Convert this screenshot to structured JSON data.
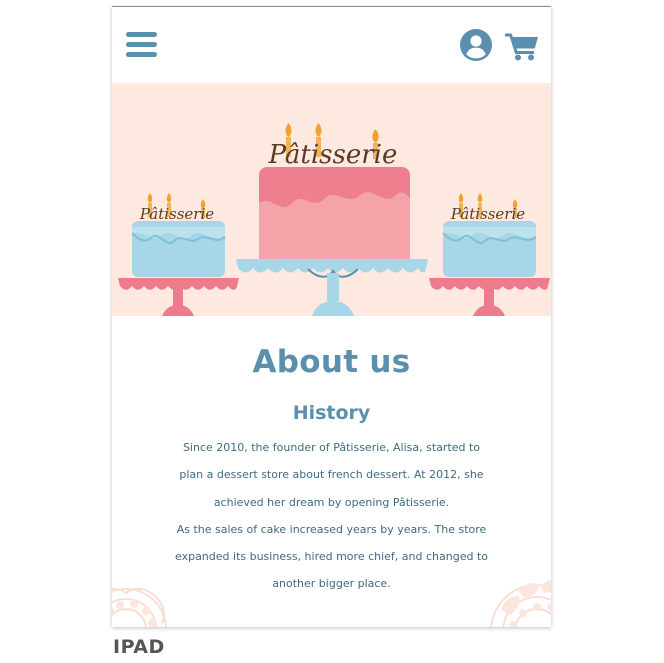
{
  "header": {
    "menu_icon": "hamburger-menu-icon",
    "account_icon": "user-circle-icon",
    "cart_icon": "shopping-cart-icon"
  },
  "hero": {
    "brand_main": "Pâtisserie",
    "brand_left": "Pâtisserie",
    "brand_right": "Pâtisserie"
  },
  "about": {
    "title": "About us",
    "subtitle": "History",
    "lines": [
      "Since 2010, the founder of Pâtisserie, Alisa, started to",
      "plan a dessert store about french dessert. At 2012, she",
      "achieved her dream by opening Pâtisserie.",
      "As the sales of cake increased years by years. The store",
      "expanded its business, hired more chief, and changed to",
      "another bigger place."
    ]
  },
  "caption": "IPAD",
  "colors": {
    "accent": "#5a8fad",
    "hero_background": "#fde9df",
    "body_text": "#3f6a82",
    "cake_pink": "#ef7f8f",
    "cake_blue": "#a6d6e7",
    "stand_pink": "#ee7b8b",
    "stand_blue": "#a6d6e7"
  }
}
